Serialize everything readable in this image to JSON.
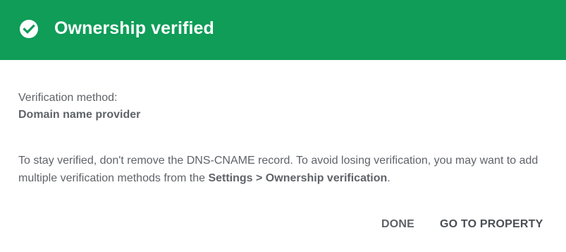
{
  "dialog": {
    "header": {
      "title": "Ownership verified",
      "icon": "check-circle-icon",
      "background_color": "#0f9d58"
    },
    "method": {
      "label": "Verification method:",
      "value": "Domain name provider"
    },
    "notice": {
      "text_before": "To stay verified, don't remove the DNS-CNAME record. To avoid losing verification, you may want to add multiple verification methods from the ",
      "link_text": "Settings > Ownership verification",
      "text_after": "."
    },
    "actions": {
      "done_label": "DONE",
      "go_to_property_label": "GO TO PROPERTY"
    }
  }
}
